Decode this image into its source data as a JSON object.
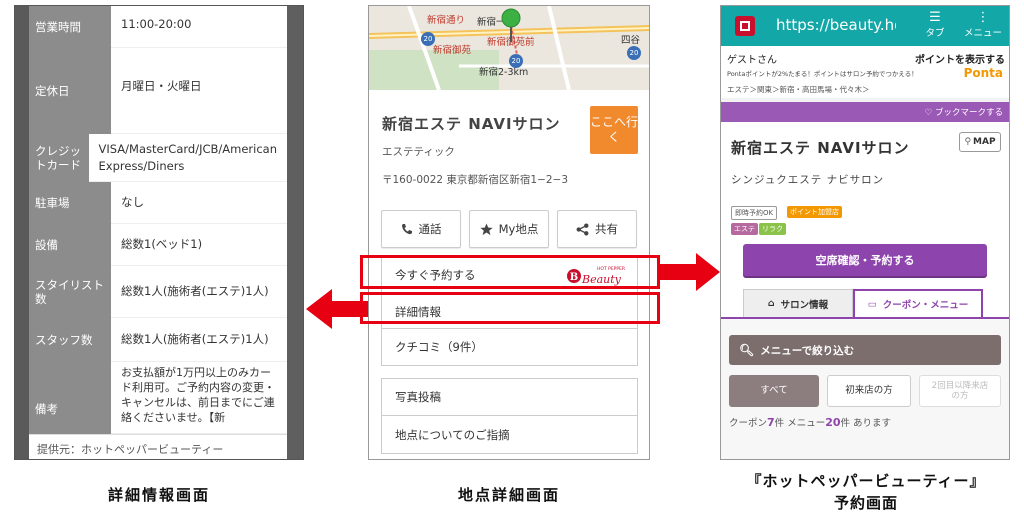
{
  "detail_screen": {
    "rows": [
      {
        "label": "営業時間",
        "value": "11:00-20:00"
      },
      {
        "label": "定休日",
        "value": "月曜日・火曜日"
      },
      {
        "label": "クレジットカード",
        "value": "VISA/MasterCard/JCB/American Express/Diners"
      },
      {
        "label": "駐車場",
        "value": "なし"
      },
      {
        "label": "設備",
        "value": "総数1(ベッド1)"
      },
      {
        "label": "スタイリスト数",
        "value": "総数1人(施術者(エステ)1人)"
      },
      {
        "label": "スタッフ数",
        "value": "総数1人(施術者(エステ)1人)"
      },
      {
        "label": "備考",
        "value": "お支払額が1万円以上のみカード利用可。ご予約内容の変更・キャンセルは、前日までにご連絡くださいませ。【新"
      }
    ],
    "footer": "提供元：ホットペッパービューティー"
  },
  "spot_screen": {
    "map": {
      "labels": [
        "新宿通り",
        "新宿一",
        "新宿御苑前",
        "新宿御苑",
        "新宿2-3km",
        "四谷"
      ],
      "route_shields": [
        "20",
        "20",
        "20"
      ]
    },
    "shop_name": "新宿エステ NAVIサロン",
    "category": "エステティック",
    "address": "〒160-0022 東京都新宿区新宿1−2−3",
    "goto_button": "ここへ行く",
    "actions": [
      "通話",
      "My地点",
      "共有"
    ],
    "reserve_now": "今すぐ予約する",
    "beauty_logo": {
      "small": "HOT PEPPER",
      "big": "Beauty"
    },
    "details": "詳細情報",
    "reviews": "クチコミ（9件）",
    "photo_post": "写真投稿",
    "feedback": "地点についてのご指摘"
  },
  "hpb_screen": {
    "url": "https://beauty.ho",
    "tab_label": "タブ",
    "menu_label": "メニュー",
    "guest": "ゲストさん",
    "show_points": "ポイントを表示する",
    "ponta_note": "Pontaポイントが2%たまる！ポイントはサロン予約でつかえる！",
    "ponta_logo": "Ponta",
    "breadcrumb": "エステ＞関東＞新宿・高田馬場・代々木＞",
    "bookmark": "ブックマークする",
    "shop_name": "新宿エステ NAVIサロン",
    "shop_kana": "シンジュクエステ ナビサロン",
    "map_button": "MAP",
    "tags": [
      "即時予約OK",
      "ポイント加盟店",
      "エステ",
      "リラク"
    ],
    "reserve_button": "空席確認・予約する",
    "tab_salon": "サロン情報",
    "tab_coupon": "クーポン・メニュー",
    "filter_button": "メニューで絞り込む",
    "seg_all": "すべて",
    "seg_first": "初来店の方",
    "seg_repeat": "2回目以降来店の方",
    "count": {
      "coupon_label": "クーポン",
      "coupon_num": "7",
      "coupon_unit": "件 メニュー",
      "menu_num": "20",
      "menu_unit": "件 あります"
    }
  },
  "captions": {
    "left": "詳細情報画面",
    "middle": "地点詳細画面",
    "right_line1": "『ホットペッパービューティー』",
    "right_line2": "予約画面"
  },
  "colors": {
    "highlight": "#e60012",
    "hpb_purple": "#8e44ad",
    "teal": "#13a7a8",
    "orange": "#f08a2c"
  }
}
